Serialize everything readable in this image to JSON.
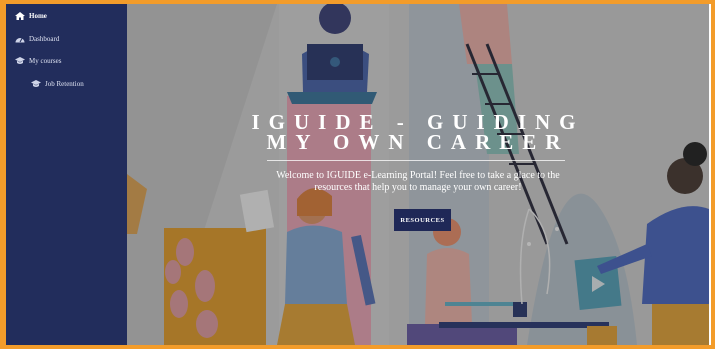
{
  "sidebar": {
    "items": [
      {
        "label": "Home",
        "icon": "home-icon",
        "active": true
      },
      {
        "label": "Dashboard",
        "icon": "dashboard-icon",
        "active": false
      },
      {
        "label": "My courses",
        "icon": "graduation-cap-icon",
        "active": false
      },
      {
        "label": "Job Retention",
        "icon": "graduation-cap-icon",
        "active": false
      }
    ]
  },
  "hero": {
    "title_line1": "IGUIDE - GUIDING",
    "title_line2": "MY OWN CAREER",
    "welcome_line1": "Welcome to IGUIDE e-Learning Portal! Feel free to take a glace to the",
    "welcome_line2": "resources that help you to manage your own career!",
    "button_label": "RESOURCES"
  },
  "colors": {
    "frame": "#f39c2a",
    "sidebar": "#222d5c",
    "button": "#1f2857"
  }
}
